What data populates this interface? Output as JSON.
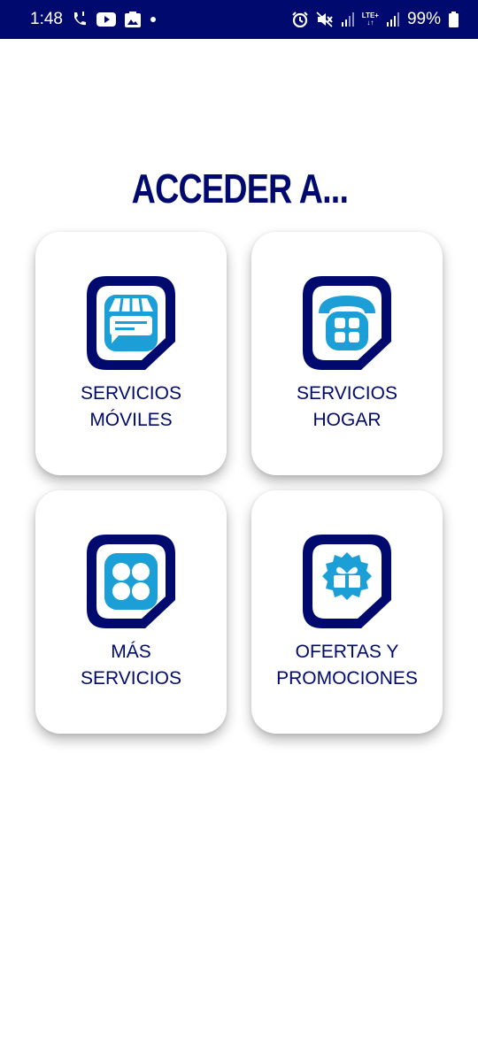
{
  "status_bar": {
    "time": "1:48",
    "battery_percent": "99%",
    "network_label_top": "LTE+",
    "background_color": "#000a6e",
    "left_icons": [
      "wifi-calling-icon",
      "youtube-icon",
      "gallery-icon",
      "dot-icon"
    ],
    "right_icons": [
      "alarm-icon",
      "mute-icon",
      "signal-icon",
      "lte-icon",
      "signal-icon",
      "battery-icon"
    ]
  },
  "page": {
    "title": "ACCEDER A...",
    "title_color": "#000a6e",
    "accent_color": "#1c9fd6"
  },
  "cards": [
    {
      "line1": "SERVICIOS",
      "line2": "MÓVILES",
      "icon": "mobile-store-icon"
    },
    {
      "line1": "SERVICIOS",
      "line2": "HOGAR",
      "icon": "home-phone-icon"
    },
    {
      "line1": "MÁS",
      "line2": "SERVICIOS",
      "icon": "more-services-icon"
    },
    {
      "line1": "OFERTAS Y",
      "line2": "PROMOCIONES",
      "icon": "gift-offer-icon"
    }
  ]
}
